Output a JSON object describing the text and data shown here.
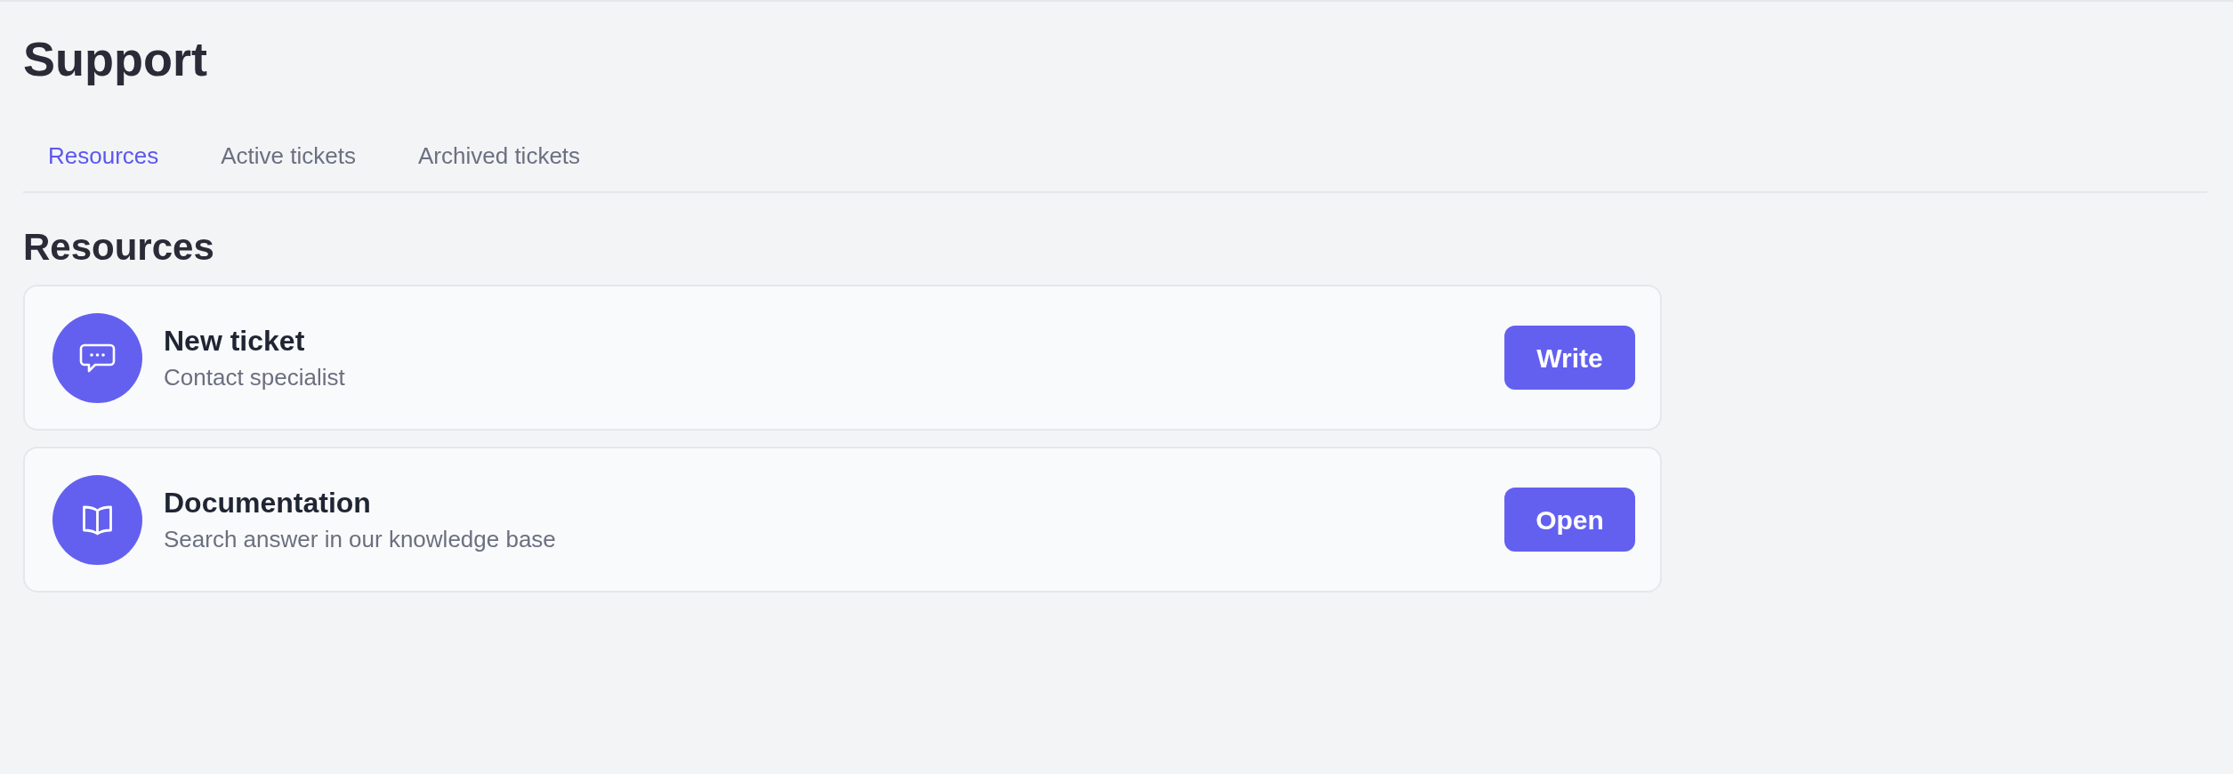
{
  "page": {
    "title": "Support"
  },
  "tabs": [
    {
      "label": "Resources",
      "selected": true
    },
    {
      "label": "Active tickets",
      "selected": false
    },
    {
      "label": "Archived tickets",
      "selected": false
    }
  ],
  "section": {
    "title": "Resources"
  },
  "resources": [
    {
      "kind": "chat",
      "title": "New ticket",
      "subtitle": "Contact specialist",
      "button": "Write"
    },
    {
      "kind": "book",
      "title": "Documentation",
      "subtitle": "Search answer in our knowledge base",
      "button": "Open"
    }
  ]
}
